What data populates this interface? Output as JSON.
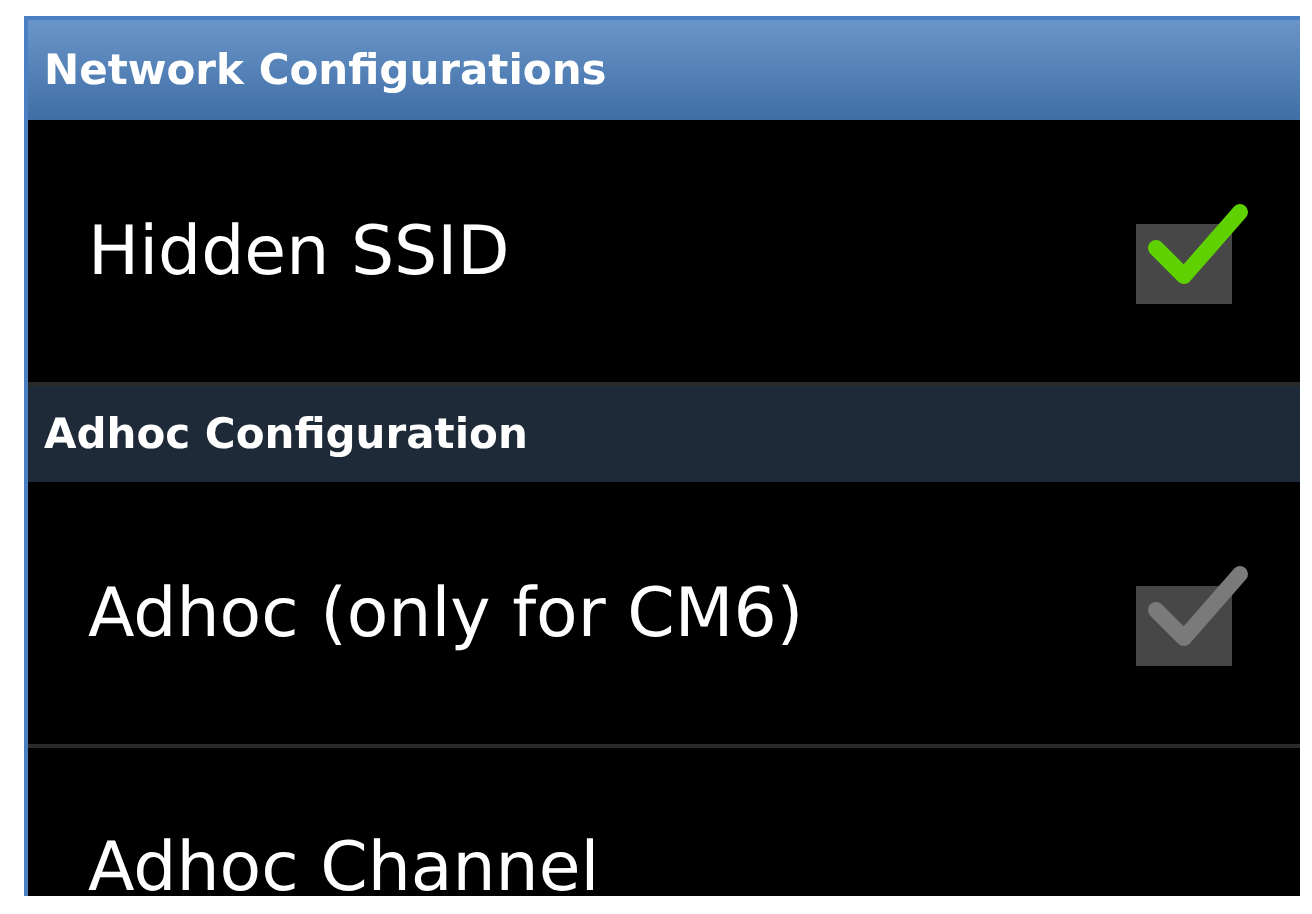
{
  "title_bar": {
    "title": "Network Configurations"
  },
  "items": [
    {
      "kind": "checkbox",
      "label": "Hidden SSID",
      "checked": true,
      "disabled": false
    },
    {
      "kind": "header",
      "label": "Adhoc Configuration"
    },
    {
      "kind": "checkbox",
      "label": "Adhoc (only for CM6)",
      "checked": true,
      "disabled": true
    },
    {
      "kind": "text",
      "label": "Adhoc Channel"
    }
  ]
}
